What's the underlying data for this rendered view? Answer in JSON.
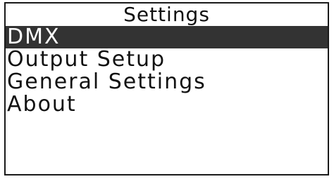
{
  "screen": {
    "title": "Settings",
    "selected_index": 0,
    "menu_items": [
      {
        "label": "DMX"
      },
      {
        "label": "Output Setup"
      },
      {
        "label": "General Settings"
      },
      {
        "label": "About"
      }
    ]
  },
  "colors": {
    "selection_background": "#333333",
    "selection_text": "#ffffff",
    "text": "#111111",
    "background": "#ffffff"
  }
}
